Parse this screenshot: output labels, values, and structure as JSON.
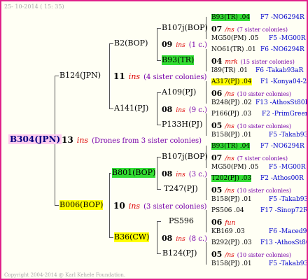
{
  "header": {
    "date": "25- 10-2014 ( 15: 35)"
  },
  "footer": {
    "copyright": "Copyright 2004-2014 @ Karl Kehele Foundation."
  },
  "root": {
    "name": "B304(JPN)",
    "count": "13",
    "ins": "ins",
    "note": "(Drones from 3 sister colonies)"
  },
  "l1": [
    {
      "name": "B124(JPN)",
      "count": "11",
      "ins": "ins",
      "note": "(4 sister colonies)"
    },
    {
      "name": "B006(BOP)",
      "count": "10",
      "ins": "ins",
      "note": "(3 sister colonies)"
    }
  ],
  "l2": [
    {
      "name": "B2(BOP)"
    },
    {
      "name": "A141(PJ)"
    },
    {
      "name": "B801(BOP)",
      "count": "08",
      "ins": "ins",
      "note": "(3 c.)"
    },
    {
      "name": "B36(CW)",
      "count": "08",
      "ins": "ins",
      "note": "(8 c.)"
    }
  ],
  "l3": [
    {
      "name": "B107j(BOP)",
      "count": "09",
      "ins": "ins",
      "note": "(1 c.)"
    },
    {
      "name": "B93(TR)"
    },
    {
      "name": "A109(PJ)",
      "count": "08",
      "ins": "ins",
      "note": "(9 c.)"
    },
    {
      "name": "P133H(PJ)"
    },
    {
      "name": "B107j(BOP)"
    },
    {
      "name": "T247(PJ)"
    },
    {
      "name": "PS596",
      "count": "08",
      "ins": "ins",
      "note": "(8 c.)"
    },
    {
      "name": "B124(PJ)"
    }
  ],
  "leaves": [
    {
      "left": "B93(TR) .04",
      "right": "F7 -NO6294R",
      "count": "07",
      "ins": "/ns",
      "note": "(7 sister colonies)",
      "bottom_left": "MG50(PM) .05",
      "bottom_right": "F5 -MG00R"
    },
    {
      "left": "NO61(TR) .01",
      "right": "F6 -NO6294R",
      "count": "04",
      "ins": "mrk",
      "note": "(15 sister colonies)",
      "bottom_left": "I89(TR) .01",
      "bottom_right": "F6 -Takab93aR"
    },
    {
      "left": "A317(PJ) .04",
      "right": "F1 -Konya04-2",
      "count": "06",
      "ins": "/ns",
      "note": "(10 sister colonies)",
      "bottom_left": "B248(PJ) .02",
      "bottom_right": "F13 -AthosSt80R"
    },
    {
      "left": "P166(PJ) .03",
      "right": "F2 -PrimGreen00",
      "count": "05",
      "ins": "/ns",
      "note": "(10 sister colonies)",
      "bottom_left": "B158(PJ) .01",
      "bottom_right": "F5 -Takab93R"
    },
    {
      "left": "B93(TR) .04",
      "right": "F7 -NO6294R",
      "count": "07",
      "ins": "/ns",
      "note": "(7 sister colonies)",
      "bottom_left": "MG50(PM) .05",
      "bottom_right": "F5 -MG00R"
    },
    {
      "left": "T202(PJ) .03",
      "right": "F2 -Athos00R",
      "count": "05",
      "ins": "/ns",
      "note": "(10 sister colonies)",
      "bottom_left": "B158(PJ) .01",
      "bottom_right": "F5 -Takab93R"
    },
    {
      "left": "PS506 .04",
      "right": "F17 -Sinop72R",
      "count": "06",
      "ins": "fun",
      "note": "",
      "bottom_left": "KB169 .03",
      "bottom_right": "F6 -Maced93R"
    },
    {
      "left": "B292(PJ) .03",
      "right": "F13 -AthosSt80R",
      "count": "05",
      "ins": "/ns",
      "note": "(10 sister colonies)",
      "bottom_left": "B158(PJ) .01",
      "bottom_right": "F5 -Takab93R"
    }
  ]
}
